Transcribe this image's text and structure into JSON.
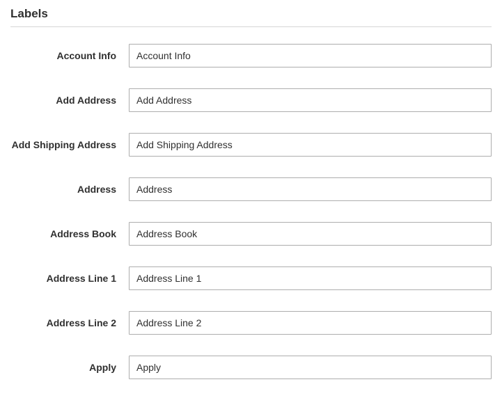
{
  "section": {
    "title": "Labels"
  },
  "fields": [
    {
      "label": "Account Info",
      "value": "Account Info"
    },
    {
      "label": "Add Address",
      "value": "Add Address"
    },
    {
      "label": "Add Shipping Address",
      "value": "Add Shipping Address"
    },
    {
      "label": "Address",
      "value": "Address"
    },
    {
      "label": "Address Book",
      "value": "Address Book"
    },
    {
      "label": "Address Line 1",
      "value": "Address Line 1"
    },
    {
      "label": "Address Line 2",
      "value": "Address Line 2"
    },
    {
      "label": "Apply",
      "value": "Apply"
    }
  ]
}
